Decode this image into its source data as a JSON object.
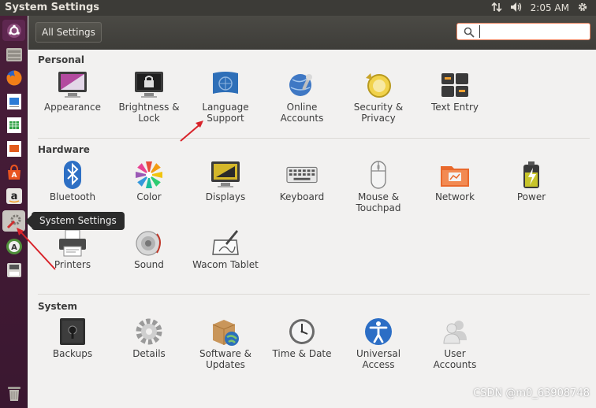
{
  "top_panel": {
    "title": "System Settings",
    "time": "2:05 AM",
    "icons": [
      "network-icon",
      "volume-icon",
      "gear-icon"
    ]
  },
  "toolbar": {
    "all_settings_label": "All Settings",
    "search_value": "",
    "search_placeholder": ""
  },
  "sections": {
    "personal": {
      "title": "Personal",
      "items": [
        {
          "label": "Appearance"
        },
        {
          "label": "Brightness &\nLock"
        },
        {
          "label": "Language\nSupport"
        },
        {
          "label": "Online\nAccounts"
        },
        {
          "label": "Security &\nPrivacy"
        },
        {
          "label": "Text Entry"
        }
      ]
    },
    "hardware": {
      "title": "Hardware",
      "items": [
        {
          "label": "Bluetooth"
        },
        {
          "label": "Color"
        },
        {
          "label": "Displays"
        },
        {
          "label": "Keyboard"
        },
        {
          "label": "Mouse &\nTouchpad"
        },
        {
          "label": "Network"
        },
        {
          "label": "Power"
        },
        {
          "label": "Printers"
        },
        {
          "label": "Sound"
        },
        {
          "label": "Wacom Tablet"
        }
      ]
    },
    "system": {
      "title": "System",
      "items": [
        {
          "label": "Backups"
        },
        {
          "label": "Details"
        },
        {
          "label": "Software &\nUpdates"
        },
        {
          "label": "Time & Date"
        },
        {
          "label": "Universal\nAccess"
        },
        {
          "label": "User\nAccounts"
        }
      ]
    }
  },
  "launcher": {
    "tooltip": "System Settings",
    "items": [
      "ubuntu-dash-icon",
      "files-icon",
      "firefox-icon",
      "writer-icon",
      "calc-icon",
      "impress-icon",
      "software-center-icon",
      "amazon-icon",
      "system-settings-icon",
      "software-updater-icon",
      "disk-icon",
      "trash-icon"
    ]
  },
  "watermark": "CSDN @m0_63908748",
  "colors": {
    "launcher_bg": "#4a1e3a",
    "panel_bg": "#3c3b37",
    "accent": "#e95420",
    "annotation_arrow": "#d8232a"
  }
}
